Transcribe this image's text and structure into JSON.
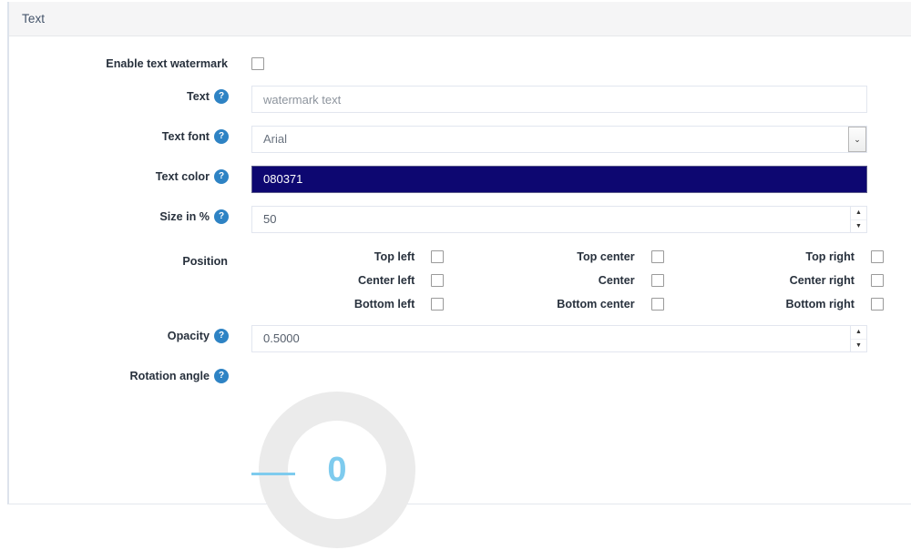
{
  "panel": {
    "tab_label": "Text"
  },
  "form": {
    "enable_watermark": {
      "label": "Enable text watermark",
      "checked": false,
      "has_help": false
    },
    "text": {
      "label": "Text",
      "placeholder": "watermark text",
      "value": "",
      "help_glyph": "?"
    },
    "text_font": {
      "label": "Text font",
      "selected": "Arial",
      "help_glyph": "?",
      "arrow_glyph": "⌄"
    },
    "text_color": {
      "label": "Text color",
      "value": "080371",
      "swatch_hex": "#0d0771",
      "help_glyph": "?"
    },
    "size_percent": {
      "label": "Size in %",
      "value": "50",
      "help_glyph": "?",
      "up_glyph": "▲",
      "down_glyph": "▼"
    },
    "position": {
      "label": "Position",
      "options": [
        {
          "label": "Top left",
          "checked": false
        },
        {
          "label": "Top center",
          "checked": false
        },
        {
          "label": "Top right",
          "checked": false
        },
        {
          "label": "Center left",
          "checked": false
        },
        {
          "label": "Center",
          "checked": false
        },
        {
          "label": "Center right",
          "checked": false
        },
        {
          "label": "Bottom left",
          "checked": false
        },
        {
          "label": "Bottom center",
          "checked": false
        },
        {
          "label": "Bottom right",
          "checked": false
        }
      ]
    },
    "opacity": {
      "label": "Opacity",
      "value": "0.5000",
      "help_glyph": "?",
      "up_glyph": "▲",
      "down_glyph": "▼"
    },
    "rotation_angle": {
      "label": "Rotation angle",
      "value": "0",
      "help_glyph": "?",
      "accent_hex": "#7ecbee",
      "track_hex": "#ebebeb"
    }
  }
}
